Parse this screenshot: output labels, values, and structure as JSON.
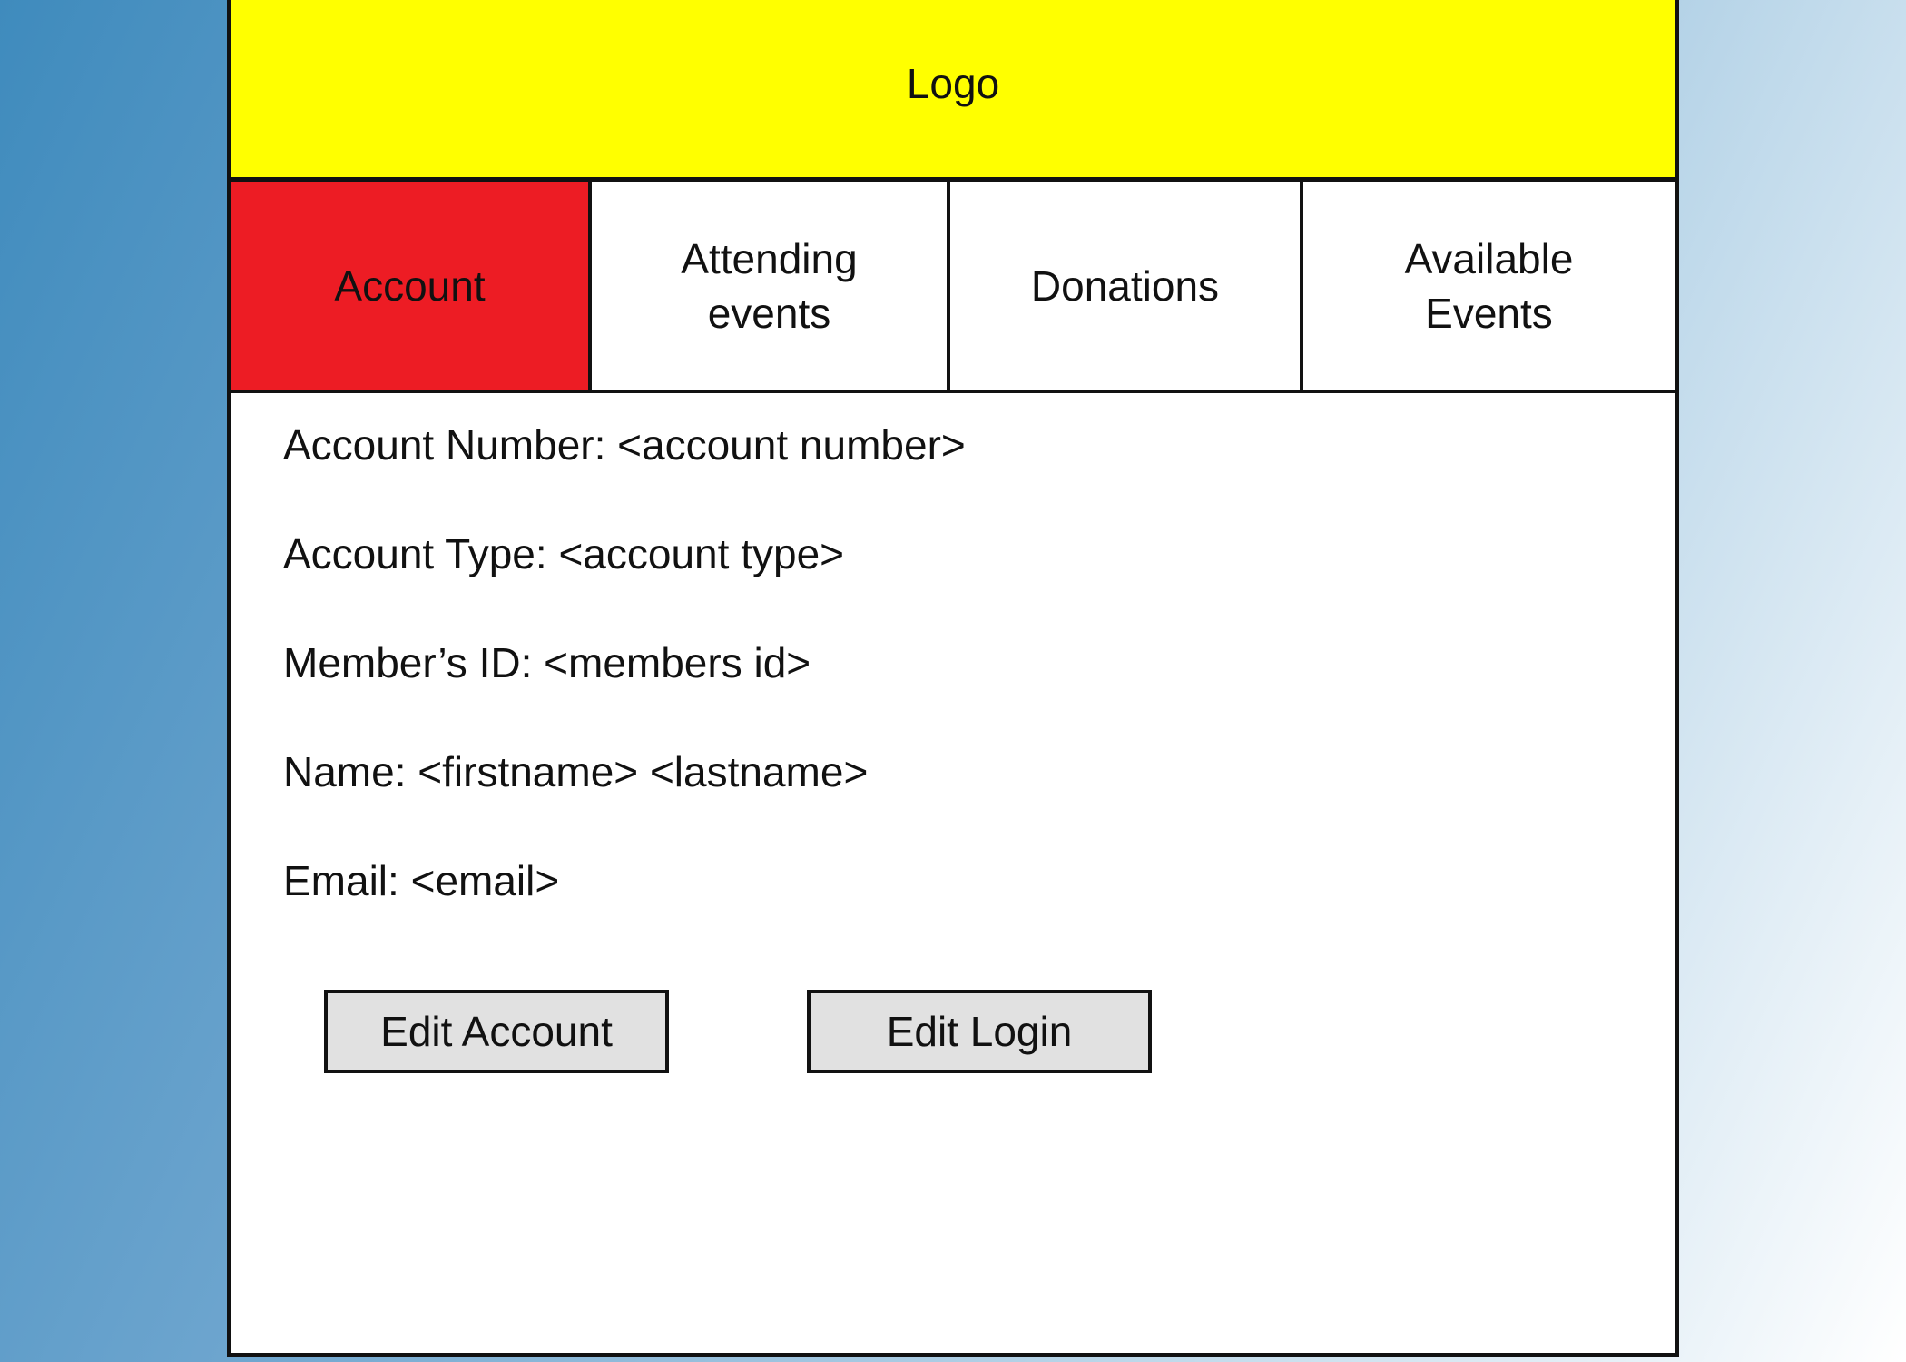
{
  "header": {
    "logo_text": "Logo"
  },
  "tabs": [
    {
      "label": "Account",
      "active": true
    },
    {
      "label": "Attending\nevents",
      "active": false
    },
    {
      "label": "Donations",
      "active": false
    },
    {
      "label": "Available\nEvents",
      "active": false
    }
  ],
  "account": {
    "fields": [
      "Account Number: <account number>",
      "Account Type: <account type>",
      "Member’s ID: <members id>",
      "Name: <firstname> <lastname>",
      "Email: <email>"
    ]
  },
  "buttons": {
    "edit_account": "Edit Account",
    "edit_login": "Edit Login"
  },
  "colors": {
    "header_bg": "#ffff00",
    "active_tab": "#ed1c24",
    "button_bg": "#e1e1e1"
  }
}
